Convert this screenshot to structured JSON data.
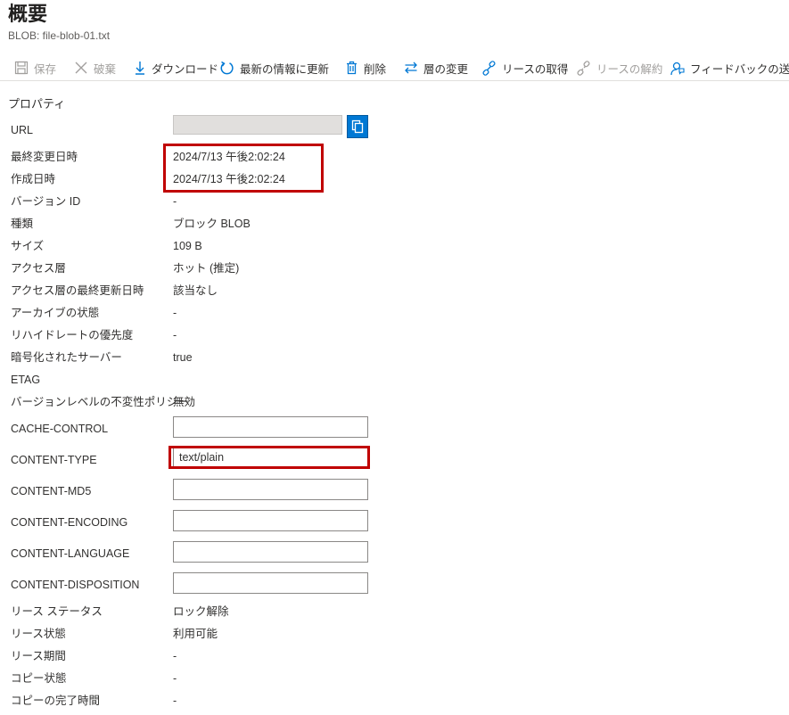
{
  "header": {
    "title": "概要",
    "subtitle": "BLOB: file-blob-01.txt"
  },
  "toolbar": {
    "save": "保存",
    "discard": "破棄",
    "download": "ダウンロード",
    "refresh": "最新の情報に更新",
    "delete": "削除",
    "change_tier": "層の変更",
    "acquire_lease": "リースの取得",
    "break_lease": "リースの解約",
    "feedback": "フィードバックの送信"
  },
  "section_title": "プロパティ",
  "properties": {
    "url": {
      "label": "URL",
      "value": ""
    },
    "last_modified": {
      "label": "最終変更日時",
      "value": "2024/7/13 午後2:02:24"
    },
    "created": {
      "label": "作成日時",
      "value": "2024/7/13 午後2:02:24"
    },
    "version_id": {
      "label": "バージョン ID",
      "value": "-"
    },
    "type": {
      "label": "種類",
      "value": "ブロック BLOB"
    },
    "size": {
      "label": "サイズ",
      "value": "109 B"
    },
    "access_tier": {
      "label": "アクセス層",
      "value": "ホット (推定)"
    },
    "tier_last_modified": {
      "label": "アクセス層の最終更新日時",
      "value": "該当なし"
    },
    "archive_status": {
      "label": "アーカイブの状態",
      "value": "-"
    },
    "rehydrate_priority": {
      "label": "リハイドレートの優先度",
      "value": "-"
    },
    "server_encrypted": {
      "label": "暗号化されたサーバー",
      "value": "true"
    },
    "etag": {
      "label": "ETAG",
      "value": ""
    },
    "immutability_policy": {
      "label": "バージョンレベルの不変性ポリシー",
      "value": "無効"
    },
    "cache_control": {
      "label": "CACHE-CONTROL",
      "value": ""
    },
    "content_type": {
      "label": "CONTENT-TYPE",
      "value": "text/plain"
    },
    "content_md5": {
      "label": "CONTENT-MD5",
      "value": ""
    },
    "content_encoding": {
      "label": "CONTENT-ENCODING",
      "value": ""
    },
    "content_language": {
      "label": "CONTENT-LANGUAGE",
      "value": ""
    },
    "content_disposition": {
      "label": "CONTENT-DISPOSITION",
      "value": ""
    },
    "lease_status": {
      "label": "リース ステータス",
      "value": "ロック解除"
    },
    "lease_state": {
      "label": "リース状態",
      "value": "利用可能"
    },
    "lease_duration": {
      "label": "リース期間",
      "value": "-"
    },
    "copy_status": {
      "label": "コピー状態",
      "value": "-"
    },
    "copy_completion_time": {
      "label": "コピーの完了時間",
      "value": "-"
    }
  },
  "colors": {
    "accent": "#0078d4",
    "highlight": "#c00000",
    "disabled": "#a19f9d"
  }
}
